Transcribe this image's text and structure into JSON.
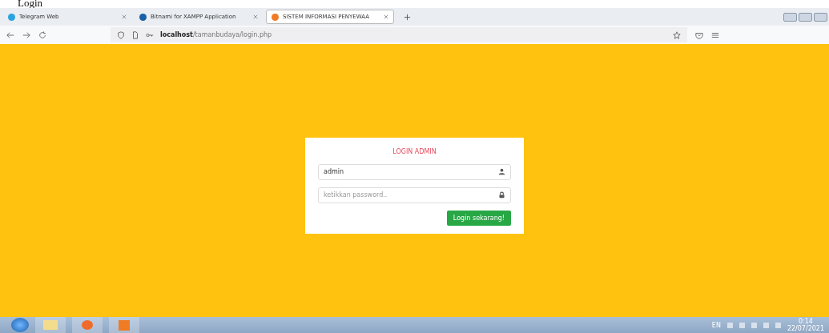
{
  "page_heading": "Login",
  "tabs": [
    {
      "label": "Telegram Web",
      "selected": false
    },
    {
      "label": "Bitnami for XAMPP Application",
      "selected": false
    },
    {
      "label": "SISTEM INFORMASI PENYEWAA",
      "selected": true
    }
  ],
  "address": {
    "host": "localhost",
    "path": "/tamanbudaya/login.php"
  },
  "login": {
    "title": "LOGIN ADMIN",
    "username": {
      "value": "admin"
    },
    "password": {
      "placeholder": "ketikkan password.."
    },
    "submit": "Login sekarang!"
  },
  "taskbar": {
    "language": "EN",
    "time": "0:14",
    "date": "22/07/2021"
  }
}
